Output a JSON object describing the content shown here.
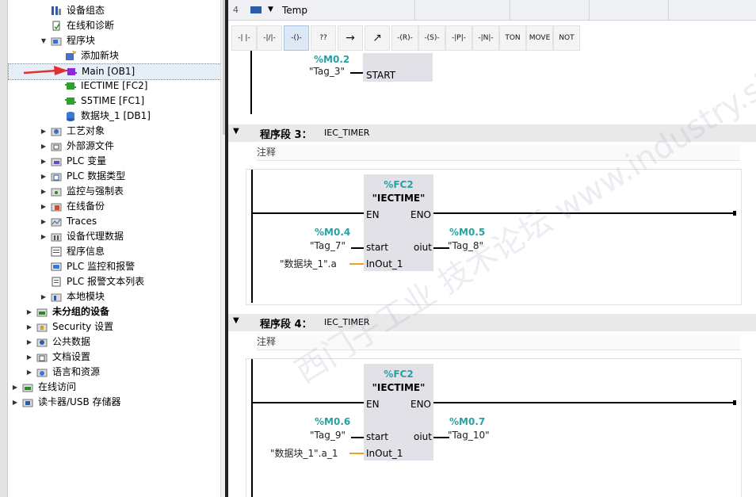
{
  "tree": {
    "items": [
      {
        "label": "设备组态",
        "icon": "device-config-icon"
      },
      {
        "label": "在线和诊断",
        "icon": "online-diag-icon"
      },
      {
        "label": "程序块",
        "icon": "folder-icon"
      },
      {
        "label": "添加新块",
        "icon": "add-block-icon"
      },
      {
        "label": "Main [OB1]",
        "icon": "ob-block-icon"
      },
      {
        "label": "IECTIME [FC2]",
        "icon": "fc-block-icon"
      },
      {
        "label": "S5TIME [FC1]",
        "icon": "fc-block-icon"
      },
      {
        "label": "数据块_1 [DB1]",
        "icon": "db-block-icon"
      },
      {
        "label": "工艺对象",
        "icon": "tech-object-icon"
      },
      {
        "label": "外部源文件",
        "icon": "ext-source-icon"
      },
      {
        "label": "PLC 变量",
        "icon": "plc-tag-icon"
      },
      {
        "label": "PLC 数据类型",
        "icon": "plc-datatype-icon"
      },
      {
        "label": "监控与强制表",
        "icon": "watch-table-icon"
      },
      {
        "label": "在线备份",
        "icon": "backup-icon"
      },
      {
        "label": "Traces",
        "icon": "traces-icon"
      },
      {
        "label": "设备代理数据",
        "icon": "proxy-data-icon"
      },
      {
        "label": "程序信息",
        "icon": "program-info-icon"
      },
      {
        "label": "PLC 监控和报警",
        "icon": "alarm-icon"
      },
      {
        "label": "PLC 报警文本列表",
        "icon": "alarm-text-icon"
      },
      {
        "label": "本地模块",
        "icon": "local-module-icon"
      },
      {
        "label": "未分组的设备",
        "icon": "ungrouped-icon"
      },
      {
        "label": "Security 设置",
        "icon": "security-icon"
      },
      {
        "label": "公共数据",
        "icon": "common-data-icon"
      },
      {
        "label": "文档设置",
        "icon": "doc-settings-icon"
      },
      {
        "label": "语言和资源",
        "icon": "language-icon"
      },
      {
        "label": "在线访问",
        "icon": "online-access-icon"
      },
      {
        "label": "读卡器/USB 存储器",
        "icon": "card-reader-icon"
      }
    ]
  },
  "interface_row": {
    "index": "4",
    "name": "Temp"
  },
  "toolbar": {
    "buttons": [
      "-| |-",
      "-|/|-",
      "-()-",
      "??",
      "→",
      "↗",
      "-(R)-",
      "-(S)-",
      "-|P|-",
      "-|N|-",
      "TON",
      "MOVE",
      "NOT"
    ]
  },
  "network_top": {
    "addr": "%M0.2",
    "tag": "\"Tag_3\"",
    "pin": "START"
  },
  "networks": [
    {
      "title": "程序段 3：",
      "name": "IEC_TIMER",
      "comment": "注释",
      "block_addr": "%FC2",
      "block_name": "\"IECTIME\"",
      "en": "EN",
      "eno": "ENO",
      "in_addr": "%M0.4",
      "in_tag": "\"Tag_7\"",
      "in_pin": "start",
      "out_pin": "oiut",
      "out_addr": "%M0.5",
      "out_tag": "\"Tag_8\"",
      "inout_tag": "\"数据块_1\".a",
      "inout_pin": "InOut_1"
    },
    {
      "title": "程序段 4：",
      "name": "IEC_TIMER",
      "comment": "注释",
      "block_addr": "%FC2",
      "block_name": "\"IECTIME\"",
      "en": "EN",
      "eno": "ENO",
      "in_addr": "%M0.6",
      "in_tag": "\"Tag_9\"",
      "in_pin": "start",
      "out_pin": "oiut",
      "out_addr": "%M0.7",
      "out_tag": "\"Tag_10\"",
      "inout_tag": "\"数据块_1\".a_1",
      "inout_pin": "InOut_1"
    }
  ],
  "watermark": "西门子工业 技术论坛 www.industry.siemens.com/cs",
  "colors": {
    "address": "#2aa0a0",
    "inout_wire": "#f0a020",
    "selection_arrow": "#e03030"
  }
}
